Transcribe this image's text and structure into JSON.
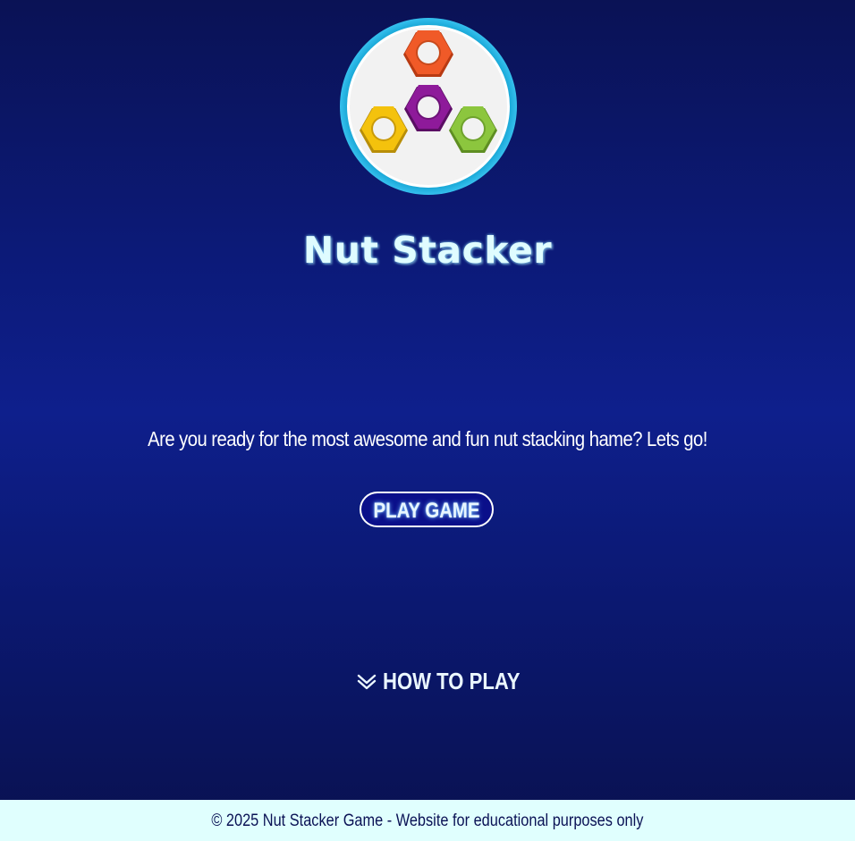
{
  "logo": {
    "icon": "hex-nuts-logo-icon",
    "colors": {
      "ring": "#1aa9d8",
      "background": "#f2f2f2",
      "top_nut": "#f05a28",
      "center_nut": "#8e1a9a",
      "left_nut": "#f4c20d",
      "right_nut": "#8cc63e"
    }
  },
  "title": "Nut Stacker",
  "tagline": "Are you ready for the most awesome and fun nut stacking hame? Lets go!",
  "play_button": {
    "label": "PLAY GAME"
  },
  "how_to_play": {
    "icon": "double-chevron-down-icon",
    "label": "HOW TO PLAY"
  },
  "footer": {
    "text": "© 2025 Nut Stacker Game - Website for educational purposes only"
  },
  "theme": {
    "background_top": "#0a1255",
    "background_mid": "#0e1f8c",
    "footer_bg": "#e0fffe",
    "button_bg": "#0a0f8a"
  }
}
